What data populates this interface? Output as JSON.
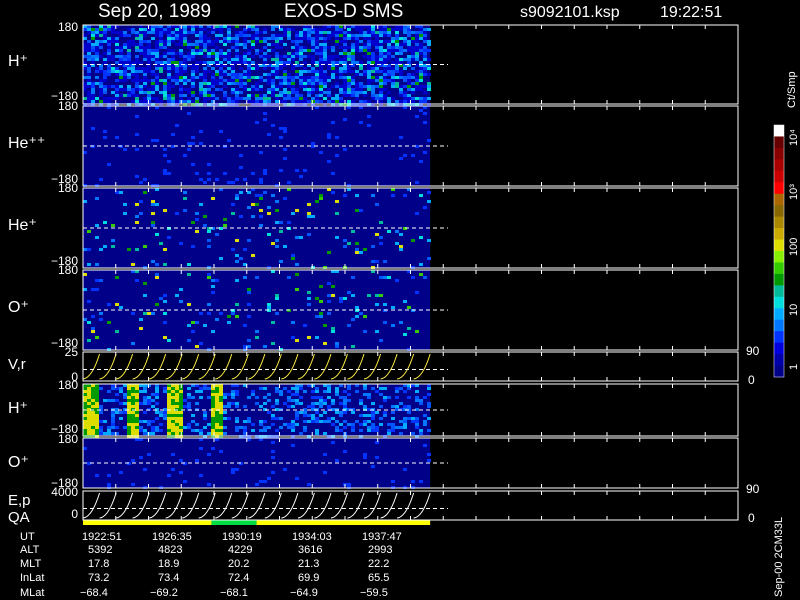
{
  "header": {
    "date": "Sep 20, 1989",
    "mission": "EXOS-D SMS",
    "file": "s9092101.ksp",
    "time": "19:22:51"
  },
  "colorbar": {
    "unit": "Ct/Smp",
    "ticks": [
      {
        "label": "1",
        "value": 1
      },
      {
        "label": "10",
        "value": 10
      },
      {
        "label": "100",
        "value": 100
      },
      {
        "label": "10³",
        "value": 1000
      },
      {
        "label": "10⁴",
        "value": 10000
      }
    ],
    "colors": [
      "#000088",
      "#0000aa",
      "#0000dd",
      "#0033ff",
      "#0077ff",
      "#00aaff",
      "#00dddd",
      "#00bb99",
      "#009900",
      "#33cc00",
      "#88ee00",
      "#dddd00",
      "#ccaa00",
      "#aa8800",
      "#886600",
      "#aa6600",
      "#ff0000",
      "#cc0000",
      "#aa0000",
      "#880000",
      "#660000",
      "#ffffff"
    ]
  },
  "footer": {
    "side_label": "Sep-00 2CM33L",
    "row_labels": [
      "UT",
      "ALT",
      "MLT",
      "InLat",
      "MLat"
    ],
    "columns": [
      {
        "ut": "1922:51",
        "alt": "5392",
        "mlt": "17.8",
        "inlat": "73.2",
        "mlat": "−68.4"
      },
      {
        "ut": "1926:35",
        "alt": "4823",
        "mlt": "18.9",
        "inlat": "73.4",
        "mlat": "−69.2"
      },
      {
        "ut": "1930:19",
        "alt": "4229",
        "mlt": "20.2",
        "inlat": "72.4",
        "mlat": "−68.1"
      },
      {
        "ut": "1934:03",
        "alt": "3616",
        "mlt": "21.3",
        "inlat": "69.9",
        "mlat": "−64.9"
      },
      {
        "ut": "1937:47",
        "alt": "2993",
        "mlt": "22.2",
        "inlat": "65.5",
        "mlat": "−59.5"
      }
    ]
  },
  "chart_data": {
    "type": "heatmap",
    "title": "EXOS-D SMS",
    "x_ticks": [
      "1922:51",
      "1926:35",
      "1930:19",
      "1934:03",
      "1937:47"
    ],
    "data_coverage_fraction_of_axis": 0.53,
    "panels": [
      {
        "label": "H⁺",
        "ylim": [
          -180,
          180
        ],
        "ytick_top": "180",
        "ytick_bottom": "−180",
        "kind": "spectrogram",
        "intensity": "high"
      },
      {
        "label": "He⁺⁺",
        "ylim": [
          -180,
          180
        ],
        "ytick_top": "180",
        "ytick_bottom": "−180",
        "kind": "spectrogram",
        "intensity": "low"
      },
      {
        "label": "He⁺",
        "ylim": [
          -180,
          180
        ],
        "ytick_top": "180",
        "ytick_bottom": "−180",
        "kind": "spectrogram",
        "intensity": "patchy"
      },
      {
        "label": "O⁺",
        "ylim": [
          -180,
          180
        ],
        "ytick_top": "180",
        "ytick_bottom": "−180",
        "kind": "spectrogram",
        "intensity": "patchy"
      },
      {
        "label": "V,r",
        "ylim": [
          0,
          25
        ],
        "ytick_top": "25",
        "ytick_bottom": "0",
        "right_top": "90",
        "right_bottom": "0",
        "kind": "line"
      },
      {
        "label": "H⁺",
        "ylim": [
          -180,
          180
        ],
        "ytick_top": "180",
        "ytick_bottom": "−180",
        "kind": "spectrogram",
        "intensity": "banded"
      },
      {
        "label": "O⁺",
        "ylim": [
          -180,
          180
        ],
        "ytick_top": "180",
        "ytick_bottom": "−180",
        "kind": "spectrogram",
        "intensity": "low"
      },
      {
        "label": "E,p",
        "ylim": [
          0,
          4000
        ],
        "ytick_top": "4000",
        "ytick_bottom": "0",
        "right_top": "90",
        "right_bottom": "0",
        "kind": "line"
      }
    ],
    "qa_label": "QA",
    "qa_segments": [
      {
        "from": 0.0,
        "to": 0.37,
        "color": "#ffff00"
      },
      {
        "from": 0.37,
        "to": 0.5,
        "color": "#00dd44"
      },
      {
        "from": 0.5,
        "to": 1.0,
        "color": "#ffff00"
      }
    ]
  }
}
